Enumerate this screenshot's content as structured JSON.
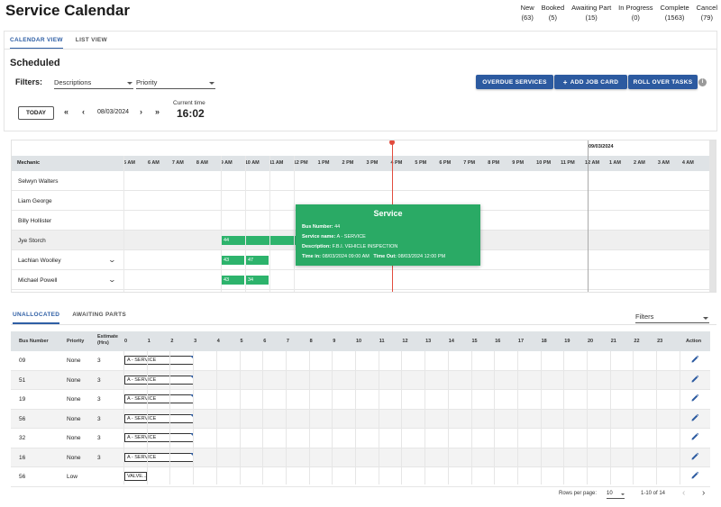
{
  "page": {
    "title": "Service Calendar"
  },
  "stats": [
    {
      "label": "New",
      "count": "(63)"
    },
    {
      "label": "Booked",
      "count": "(5)"
    },
    {
      "label": "Awaiting Part",
      "count": "(15)"
    },
    {
      "label": "In Progress",
      "count": "(0)"
    },
    {
      "label": "Complete",
      "count": "(1563)"
    },
    {
      "label": "Cancel",
      "count": "(79)"
    }
  ],
  "view_tabs": [
    {
      "label": "CALENDAR VIEW",
      "active": true
    },
    {
      "label": "LIST VIEW",
      "active": false
    }
  ],
  "section_title": "Scheduled",
  "filters": {
    "label": "Filters:",
    "descriptions": "Descriptions",
    "priority": "Priority"
  },
  "actions": {
    "overdue": "OVERDUE SERVICES",
    "add_job": "ADD JOB CARD",
    "roll_over": "ROLL OVER TASKS",
    "info": "i"
  },
  "date_nav": {
    "today": "TODAY",
    "first": "«",
    "prev": "‹",
    "date": "08/03/2024",
    "next": "›",
    "last": "»"
  },
  "current_time": {
    "label": "Current time",
    "value": "16:02"
  },
  "timeline": {
    "mechanic_header": "Mechanic",
    "hours": [
      "5 AM",
      "6 AM",
      "7 AM",
      "8 AM",
      "9 AM",
      "10 AM",
      "11 AM",
      "12 PM",
      "1 PM",
      "2 PM",
      "3 PM",
      "4 PM",
      "5 PM",
      "6 PM",
      "7 PM",
      "8 PM",
      "9 PM",
      "10 PM",
      "11 PM",
      "12 AM",
      "1 AM",
      "2 AM",
      "3 AM",
      "4 AM"
    ],
    "next_date": "09/03/2024",
    "mechanics": [
      {
        "name": "Selwyn Walters",
        "expandable": false,
        "highlight": false
      },
      {
        "name": "Liam George",
        "expandable": false,
        "highlight": false
      },
      {
        "name": "Billy Hollister",
        "expandable": false,
        "highlight": false
      },
      {
        "name": "Jye Storch",
        "expandable": false,
        "highlight": true
      },
      {
        "name": "Lachlan Woolley",
        "expandable": true,
        "highlight": false
      },
      {
        "name": "Michael Powell",
        "expandable": true,
        "highlight": false
      }
    ],
    "blocks": [
      {
        "label": "44",
        "row": 3
      },
      {
        "label": "43",
        "row": 4
      },
      {
        "label": "47",
        "row": 4
      },
      {
        "label": "43",
        "row": 5
      },
      {
        "label": "34",
        "row": 5
      }
    ],
    "tooltip": {
      "title": "Service",
      "bus_label": "Bus Number:",
      "bus": "44",
      "name_label": "Service name:",
      "name": "A - SERVICE",
      "desc_label": "Description:",
      "desc": "F.B.I. VEHICLE INSPECTION",
      "time_in_label": "Time in:",
      "time_in": "08/03/2024 09:00 AM",
      "time_out_label": "Time Out:",
      "time_out": "08/03/2024 12:00 PM"
    }
  },
  "bottom_tabs": [
    {
      "label": "UNALLOCATED",
      "active": true
    },
    {
      "label": "AWAITING PARTS",
      "active": false
    }
  ],
  "bottom_filters": "Filters",
  "table": {
    "headers": {
      "bus": "Bus Number",
      "priority": "Priority",
      "estimate_1": "Estimate",
      "estimate_2": "(Hrs)",
      "action": "Action"
    },
    "hour_cols": [
      "0",
      "1",
      "2",
      "3",
      "4",
      "5",
      "6",
      "7",
      "8",
      "9",
      "10",
      "11",
      "12",
      "13",
      "14",
      "15",
      "16",
      "17",
      "18",
      "19",
      "20",
      "21",
      "22",
      "23"
    ],
    "rows": [
      {
        "bus": "09",
        "priority": "None",
        "estimate": "3",
        "service": "A - SERVICE"
      },
      {
        "bus": "51",
        "priority": "None",
        "estimate": "3",
        "service": "A - SERVICE"
      },
      {
        "bus": "19",
        "priority": "None",
        "estimate": "3",
        "service": "A - SERVICE"
      },
      {
        "bus": "56",
        "priority": "None",
        "estimate": "3",
        "service": "A - SERVICE"
      },
      {
        "bus": "32",
        "priority": "None",
        "estimate": "3",
        "service": "A - SERVICE"
      },
      {
        "bus": "16",
        "priority": "None",
        "estimate": "3",
        "service": "A - SERVICE"
      },
      {
        "bus": "56",
        "priority": "Low",
        "estimate": "",
        "service": "VALVE..."
      }
    ]
  },
  "pagination": {
    "rows_label": "Rows per page:",
    "rows_value": "10",
    "range": "1-10 of 14",
    "prev": "‹",
    "next": "›"
  },
  "colors": {
    "accent": "#2c5aa0",
    "event": "#2db36c",
    "now_line": "#e24c3e"
  }
}
